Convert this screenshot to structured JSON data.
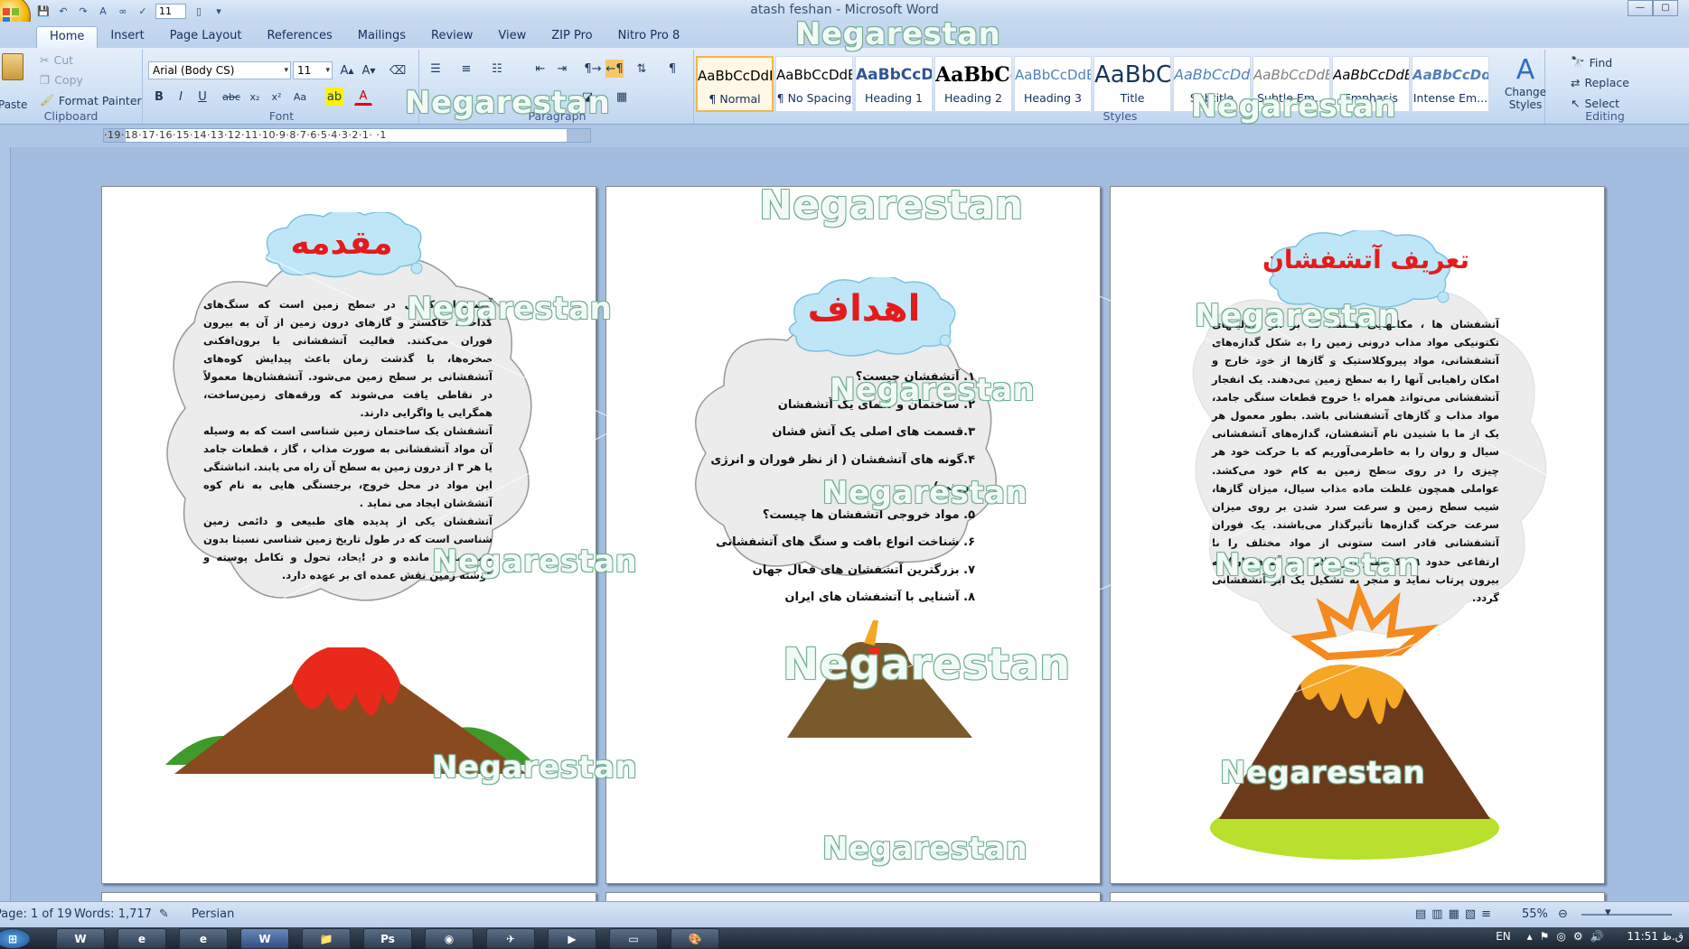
{
  "window": {
    "title": "atash feshan - Microsoft Word",
    "font_size_qat": "11"
  },
  "tabs": [
    "Home",
    "Insert",
    "Page Layout",
    "References",
    "Mailings",
    "Review",
    "View",
    "ZIP Pro",
    "Nitro Pro 8"
  ],
  "clipboard": {
    "paste": "Paste",
    "cut": "Cut",
    "copy": "Copy",
    "format_painter": "Format Painter",
    "label": "Clipboard"
  },
  "font": {
    "name": "Arial (Body CS)",
    "size": "11",
    "label": "Font",
    "bold": "B",
    "italic": "I",
    "underline": "U",
    "strike": "abc",
    "sub": "x₂",
    "sup": "x²",
    "case": "Aa",
    "color_a": "A"
  },
  "paragraph": {
    "label": "Paragraph"
  },
  "styles": {
    "label": "Styles",
    "items": [
      {
        "preview": "AaBbCcDdEe",
        "name": "¶ Normal"
      },
      {
        "preview": "AaBbCcDdEe",
        "name": "¶ No Spacing"
      },
      {
        "preview": "AaBbCcDdEe",
        "name": "Heading 1"
      },
      {
        "preview": "AaBbCcDdEe",
        "name": "Heading 2"
      },
      {
        "preview": "AaBbCcDdEe",
        "name": "Heading 3"
      },
      {
        "preview": "AaBbCcDdEe",
        "name": "Title"
      },
      {
        "preview": "AaBbCcDdEe",
        "name": "Subtitle"
      },
      {
        "preview": "AaBbCcDdEe",
        "name": "Subtle Em..."
      },
      {
        "preview": "AaBbCcDdEe",
        "name": "Emphasis"
      },
      {
        "preview": "AaBbCcDdEe",
        "name": "Intense Em..."
      }
    ],
    "change_styles": "Change Styles"
  },
  "editing": {
    "find": "Find",
    "replace": "Replace",
    "select": "Select",
    "label": "Editing"
  },
  "ruler": {
    "text": "·19·18·17·16·15·14·13·12·11·10·9·8·7·6·5·4·3·2·1·  ·1"
  },
  "pages": {
    "p1": {
      "title": "مقدمه",
      "paragraphs": [
        "آتشفشان کوهی در سطح زمین است که سنگ‌های گداخته، خاکستر و گازهای درون زمین از آن به بیرون فوران می‌کنند. فعالیت آتشفشانی با برون‌افکنی صخره‌ها، با گذشت زمان باعث پیدایش کوه‌های آتشفشانی بر سطح زمین می‌شود. آتشفشان‌ها معمولاً در نقاطی یافت می‌شوند که ورقه‌های زمین‌ساخت، همگرایی یا واگرایی دارند.",
        "آتشفشان یک ساختمان زمین شناسی است که به وسیله آن مواد آتشفشانی به صورت مذاب ، گاز ، قطعات جامد یا هر ۳ از درون زمین به سطح آن راه می یابند. انباشتگی این مواد در محل خروج، برجستگی هایی به نام کوه آتشفشان ایجاد می نماید .",
        "آتشفشان یکی از پدیده های طبیعی و دائمی زمین شناسی است که در طول تاریخ زمین شناسی نسبتا بدون تغییر باقی مانده و در ایجاد، تحول و تکامل پوسته و گوشته زمین نقش عمده ای بر عهده دارد."
      ]
    },
    "p2": {
      "title": "اهداف",
      "items": [
        "۱. آتشفشان چیست؟",
        "۲. ساختمان و شمای یک آتشفشان",
        "۳.قسمت های اصلی یک آتش فشان",
        "۴.گونه های آتشفشان ( از نظر فوران و انرژی درونی)",
        "۵. مواد خروجی آتشفشان ها چیست؟",
        "۶. شناخت انواع بافت و سنگ های آتشفشانی",
        "۷. بزرگترین آتشفشان های فعال جهان",
        "۸. آشنایی با آتشفشان های ایران"
      ]
    },
    "p3": {
      "title": "تعریف آتشفشان",
      "paragraph": "آتشفشان ها ، مکانهایی هستند که بر اثر فعالیتهای تکتونیکی مواد مذاب درونی زمین را به شکل گدازه‌های آتشفشانی، مواد پیروکلاستیک و گازها از خود خارج و امکان راهیابی آنها را به سطح زمین می‌دهند. یک انفجار آتشفشانی می‌تواند همراه با خروج قطعات سنگی جامد، مواد مذاب و گازهای آتشفشانی باشد. بطور معمول هر یک از ما با شنیدن نام آتشفشان، گدازه‌های آتشفشانی سیال و روان را به خاطرمی‌آوریم که با حرکت خود هر چیزی را در روی سطح زمین به کام خود می‌کشد. عواملی همچون غلظت ماده مذاب سیال، میزان گازها، شیب سطح زمین و سرعت سرد شدن بر روی میزان سرعت حرکت گدازه‌ها تأثیرگذار می‌باشند. یک فوران آتشفشانی قادر است ستونی از مواد مختلف را تا ارتفاعی حدود ۱۹ کیلومتر (در بالای قله آتشفشان) به بیرون پرتاب نماید و منجر به تشکیل یک ابر آتشفشانی گردد."
    }
  },
  "watermark": "Negarestan",
  "status": {
    "page": "Page: 1 of 19",
    "words": "Words: 1,717",
    "language": "Persian",
    "zoom": "55%"
  },
  "taskbar": {
    "lang": "EN",
    "time": "11:51 ق.ظ"
  },
  "colors": {
    "title_red": "#e41b1b",
    "cloud_blue": "#bfe6f7",
    "cloud_grey": "#eeeeee"
  }
}
